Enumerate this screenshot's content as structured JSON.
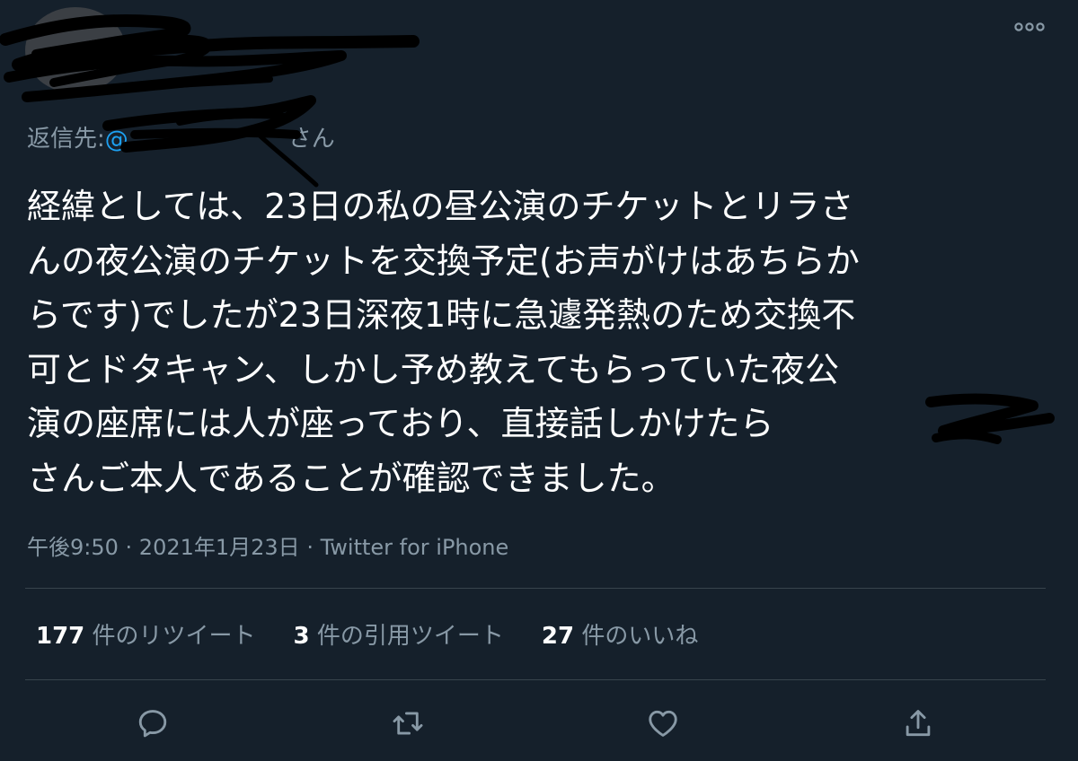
{
  "reply_to": {
    "prefix": "返信先:",
    "mention": "@",
    "suffix": "さん"
  },
  "tweet": {
    "lines": [
      "経緯としては、23日の私の昼公演のチケットとリラさ",
      "んの夜公演のチケットを交換予定(お声がけはあちらか",
      "らです)でしたが23日深夜1時に急遽発熱のため交換不",
      "可とドタキャン、しかし予め教えてもらっていた夜公",
      "演の座席には人が座っており、直接話しかけたら",
      "さんご本人であることが確認できました。"
    ]
  },
  "meta": {
    "time": "午後9:50",
    "sep1": " · ",
    "date": "2021年1月23日",
    "sep2": " · ",
    "source": "Twitter for iPhone"
  },
  "stats": {
    "retweets_count": "177",
    "retweets_label": " 件のリツイート",
    "quotes_count": "3",
    "quotes_label": " 件の引用ツイート",
    "likes_count": "27",
    "likes_label": " 件のいいね"
  },
  "actions": {
    "reply_icon": "reply-icon",
    "retweet_icon": "retweet-icon",
    "like_icon": "heart-icon",
    "share_icon": "share-icon"
  },
  "colors": {
    "background": "#15202b",
    "text": "#ffffff",
    "secondary": "#8899a6",
    "accent": "#1da1f2",
    "divider": "#38444d"
  }
}
